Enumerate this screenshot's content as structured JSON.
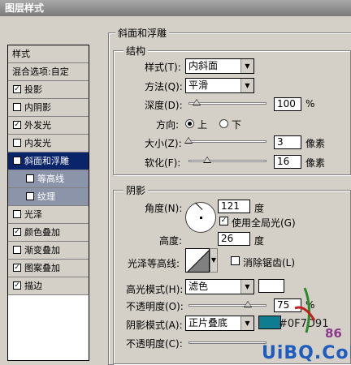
{
  "window": {
    "title": "图层样式"
  },
  "style_list": {
    "header": "样式",
    "blend_options": "混合选项:自定",
    "items": [
      {
        "label": "投影",
        "checked": true
      },
      {
        "label": "内阴影",
        "checked": false
      },
      {
        "label": "外发光",
        "checked": true
      },
      {
        "label": "内发光",
        "checked": false
      },
      {
        "label": "斜面和浮雕",
        "checked": true,
        "selected": true
      },
      {
        "label": "等高线",
        "checked": false,
        "sub": true
      },
      {
        "label": "纹理",
        "checked": false,
        "sub": true
      },
      {
        "label": "光泽",
        "checked": false
      },
      {
        "label": "颜色叠加",
        "checked": true
      },
      {
        "label": "渐变叠加",
        "checked": false
      },
      {
        "label": "图案叠加",
        "checked": true
      },
      {
        "label": "描边",
        "checked": true
      }
    ]
  },
  "bevel": {
    "title": "斜面和浮雕",
    "structure": {
      "title": "结构",
      "style_label": "样式(T):",
      "style_value": "内斜面",
      "method_label": "方法(Q):",
      "method_value": "平滑",
      "depth_label": "深度(D):",
      "depth_value": "100",
      "depth_unit": "%",
      "depth_level": 0.1,
      "direction_label": "方向:",
      "direction_up": "上",
      "direction_down": "下",
      "size_label": "大小(Z):",
      "size_value": "3",
      "size_unit": "像素",
      "soften_label": "软化(F):",
      "soften_value": "16",
      "soften_unit": "像素"
    },
    "shading": {
      "title": "阴影",
      "angle_label": "角度(N):",
      "angle_value": "121",
      "angle_unit": "度",
      "global_light_label": "使用全局光(G)",
      "altitude_label": "高度:",
      "altitude_value": "26",
      "altitude_unit": "度",
      "gloss_contour_label": "光泽等高线:",
      "antialias_label": "消除锯齿(L)",
      "highlight_mode_label": "高光模式(H):",
      "highlight_mode_value": "滤色",
      "highlight_color": "#ffffff",
      "highlight_opacity_label": "不透明度(O):",
      "highlight_opacity_value": "75",
      "highlight_opacity_unit": "%",
      "shadow_mode_label": "阴影模式(A):",
      "shadow_mode_value": "正片叠底",
      "shadow_color": "#0F7D91",
      "shadow_color_text": "#0F7D91",
      "shadow_opacity_label": "不透明度(C):"
    }
  },
  "watermark": {
    "text": "UiBQ.CoM",
    "number": "86"
  }
}
